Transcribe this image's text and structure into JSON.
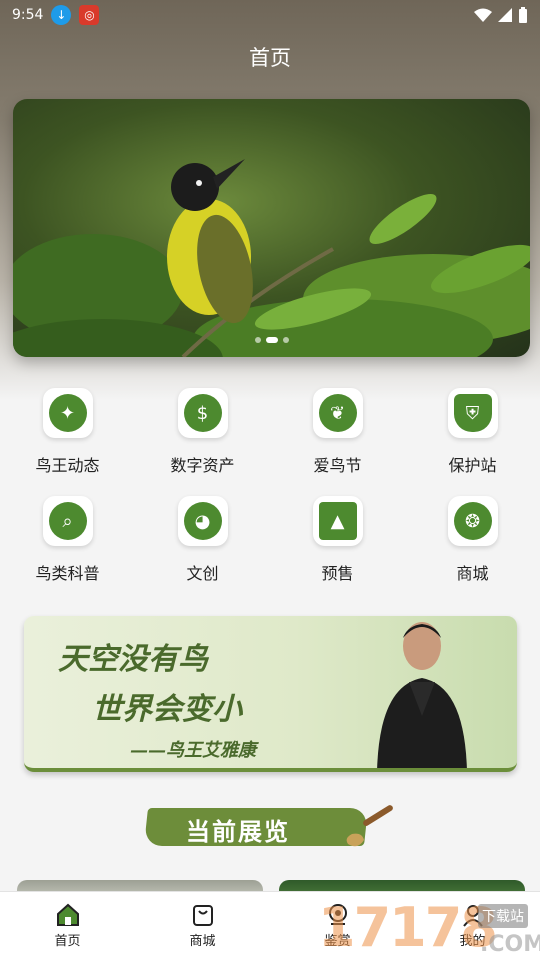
{
  "status_bar": {
    "time": "9:54"
  },
  "header": {
    "title": "首页"
  },
  "banner": {
    "slide_count": 3,
    "active_slide": 2
  },
  "grid": [
    {
      "label": "鸟王动态",
      "icon": "bird-icon"
    },
    {
      "label": "数字资产",
      "icon": "money-bag-icon"
    },
    {
      "label": "爱鸟节",
      "icon": "bird-leaf-icon"
    },
    {
      "label": "保护站",
      "icon": "shield-bird-icon"
    },
    {
      "label": "鸟类科普",
      "icon": "magnifier-icon"
    },
    {
      "label": "文创",
      "icon": "bird-head-icon"
    },
    {
      "label": "预售",
      "icon": "image-icon"
    },
    {
      "label": "商城",
      "icon": "bird-circle-icon"
    }
  ],
  "quote": {
    "line1": "天空没有鸟",
    "line2": "世界会变小",
    "line3": "——鸟王艾雅康"
  },
  "section": {
    "title": "当前展览"
  },
  "tabs": [
    {
      "label": "首页",
      "icon": "home-icon",
      "active": true
    },
    {
      "label": "商城",
      "icon": "shopping-bag-icon",
      "active": false
    },
    {
      "label": "鉴赏",
      "icon": "camera-icon",
      "active": false
    },
    {
      "label": "我的",
      "icon": "user-icon",
      "active": false
    }
  ],
  "watermark": {
    "number": "17178",
    "tag": "下载站",
    "domain": ".COM"
  },
  "colors": {
    "accent": "#4d8a2f",
    "header_bg": "#7a7265"
  }
}
